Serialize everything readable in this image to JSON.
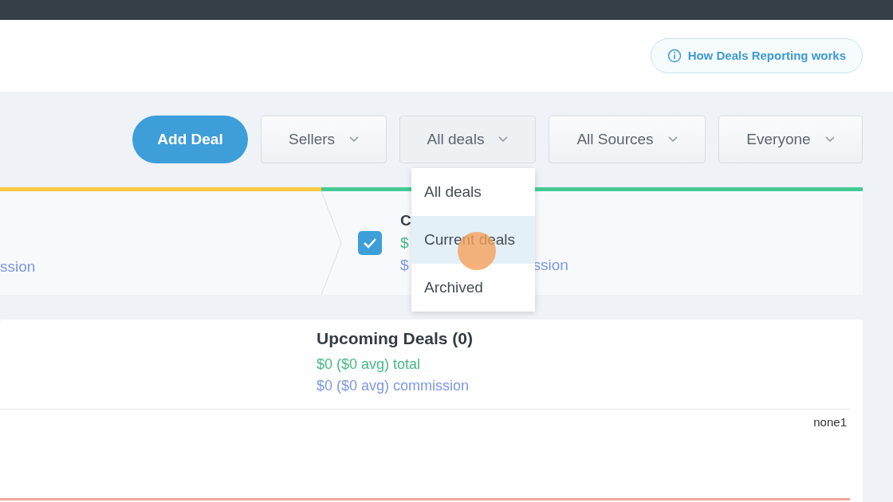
{
  "help_button": {
    "label": "How Deals Reporting works"
  },
  "add_button": {
    "label": "Add Deal"
  },
  "filters": [
    {
      "label": "Sellers",
      "open": false
    },
    {
      "label": "All deals",
      "open": true
    },
    {
      "label": "All Sources",
      "open": false
    },
    {
      "label": "Everyone",
      "open": false
    }
  ],
  "dropdown": {
    "items": [
      {
        "label": "All deals",
        "selected": false
      },
      {
        "label": "Current deals",
        "selected": true
      },
      {
        "label": "Archived",
        "selected": false
      }
    ]
  },
  "stages": [
    {
      "color": "#fbc83e",
      "commission": "ssion"
    },
    {
      "color": "#45cb96",
      "checked": true,
      "title": "C",
      "total": "$",
      "commission": "$",
      "commission_end": "ssion"
    }
  ],
  "card": {
    "title": "Upcoming Deals (0)",
    "total": "$0 ($0 avg) total",
    "commission": "$0 ($0 avg) commission",
    "column_label": "none1"
  }
}
